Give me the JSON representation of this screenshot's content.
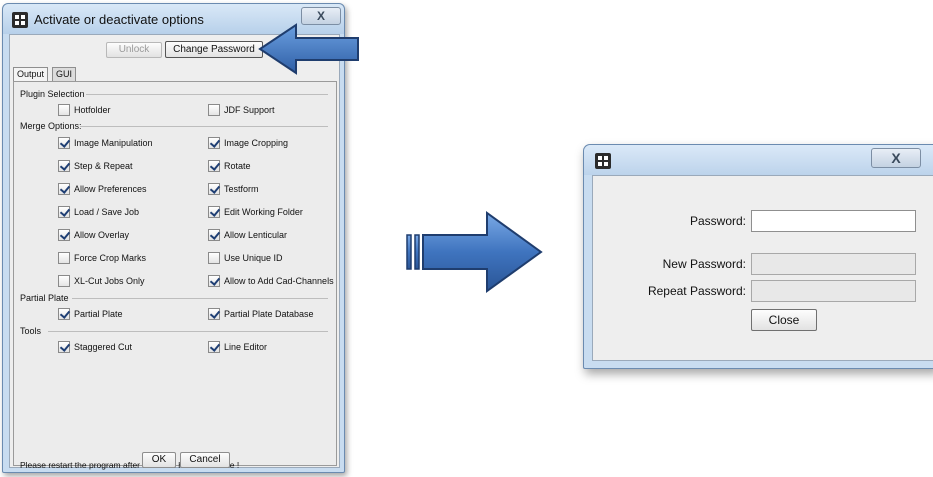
{
  "dialog1": {
    "title": "Activate or deactivate options",
    "close_glyph": "X",
    "buttons": {
      "unlock": "Unlock",
      "change_password": "Change Password",
      "ok": "OK",
      "cancel": "Cancel"
    },
    "tabs": [
      "Output",
      "GUI"
    ],
    "sections": {
      "plugin_selection": "Plugin Selection",
      "merge_options": "Merge Options:",
      "partial_plate": "Partial Plate",
      "tools": "Tools"
    },
    "options": {
      "hotfolder": {
        "label": "Hotfolder",
        "checked": false
      },
      "jdf_support": {
        "label": "JDF Support",
        "checked": false
      },
      "image_manipulation": {
        "label": "Image Manipulation",
        "checked": true
      },
      "image_cropping": {
        "label": "Image Cropping",
        "checked": true
      },
      "step_repeat": {
        "label": "Step & Repeat",
        "checked": true
      },
      "rotate": {
        "label": "Rotate",
        "checked": true
      },
      "allow_preferences": {
        "label": "Allow Preferences",
        "checked": true
      },
      "testform": {
        "label": "Testform",
        "checked": true
      },
      "load_save_job": {
        "label": "Load / Save Job",
        "checked": true
      },
      "edit_working_folder": {
        "label": "Edit Working Folder",
        "checked": true
      },
      "allow_overlay": {
        "label": "Allow Overlay",
        "checked": true
      },
      "allow_lenticular": {
        "label": "Allow Lenticular",
        "checked": true
      },
      "force_crop_marks": {
        "label": "Force Crop Marks",
        "checked": false
      },
      "use_unique_id": {
        "label": "Use Unique ID",
        "checked": false
      },
      "xl_cut_jobs_only": {
        "label": "XL-Cut Jobs Only",
        "checked": false
      },
      "allow_add_cad_channels": {
        "label": "Allow to Add Cad-Channels",
        "checked": true
      },
      "partial_plate": {
        "label": "Partial Plate",
        "checked": true
      },
      "partial_plate_database": {
        "label": "Partial Plate Database",
        "checked": true
      },
      "staggered_cut": {
        "label": "Staggered Cut",
        "checked": true
      },
      "line_editor": {
        "label": "Line Editor",
        "checked": true
      }
    },
    "note": "Please restart the program after selection has been done !"
  },
  "dialog2": {
    "close_glyph": "X",
    "labels": {
      "password": "Password:",
      "new_password": "New Password:",
      "repeat_password": "Repeat Password:"
    },
    "values": {
      "password": "",
      "new_password": "",
      "repeat_password": ""
    },
    "close_button": "Close"
  },
  "colors": {
    "arrow_blue": "#3a6db5",
    "window_frame": "#c8dcf0"
  }
}
